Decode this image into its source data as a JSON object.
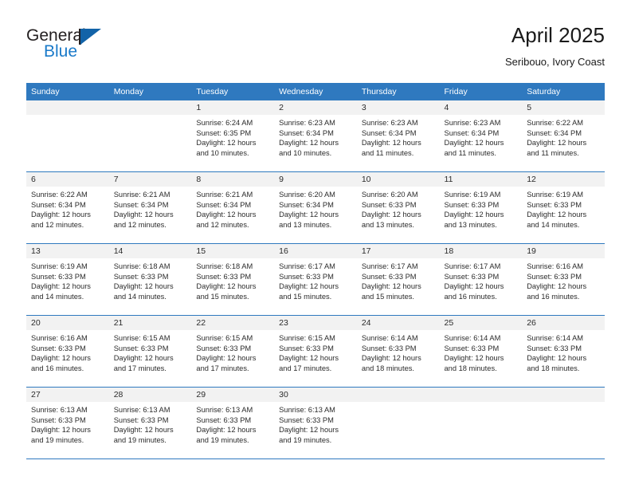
{
  "brand": {
    "name_part1": "General",
    "name_part2": "Blue",
    "logo_icon": "triangle-flag-icon"
  },
  "header": {
    "title": "April 2025",
    "subtitle": "Seribouo, Ivory Coast"
  },
  "calendar": {
    "theme_color": "#2f79bf",
    "weekday_headers": [
      "Sunday",
      "Monday",
      "Tuesday",
      "Wednesday",
      "Thursday",
      "Friday",
      "Saturday"
    ],
    "labels": {
      "sunrise": "Sunrise:",
      "sunset": "Sunset:",
      "daylight": "Daylight:"
    },
    "weeks": [
      [
        {
          "day": "",
          "empty": true
        },
        {
          "day": "",
          "empty": true
        },
        {
          "day": "1",
          "sunrise": "Sunrise: 6:24 AM",
          "sunset": "Sunset: 6:35 PM",
          "daylight_line1": "Daylight: 12 hours",
          "daylight_line2": "and 10 minutes."
        },
        {
          "day": "2",
          "sunrise": "Sunrise: 6:23 AM",
          "sunset": "Sunset: 6:34 PM",
          "daylight_line1": "Daylight: 12 hours",
          "daylight_line2": "and 10 minutes."
        },
        {
          "day": "3",
          "sunrise": "Sunrise: 6:23 AM",
          "sunset": "Sunset: 6:34 PM",
          "daylight_line1": "Daylight: 12 hours",
          "daylight_line2": "and 11 minutes."
        },
        {
          "day": "4",
          "sunrise": "Sunrise: 6:23 AM",
          "sunset": "Sunset: 6:34 PM",
          "daylight_line1": "Daylight: 12 hours",
          "daylight_line2": "and 11 minutes."
        },
        {
          "day": "5",
          "sunrise": "Sunrise: 6:22 AM",
          "sunset": "Sunset: 6:34 PM",
          "daylight_line1": "Daylight: 12 hours",
          "daylight_line2": "and 11 minutes."
        }
      ],
      [
        {
          "day": "6",
          "sunrise": "Sunrise: 6:22 AM",
          "sunset": "Sunset: 6:34 PM",
          "daylight_line1": "Daylight: 12 hours",
          "daylight_line2": "and 12 minutes."
        },
        {
          "day": "7",
          "sunrise": "Sunrise: 6:21 AM",
          "sunset": "Sunset: 6:34 PM",
          "daylight_line1": "Daylight: 12 hours",
          "daylight_line2": "and 12 minutes."
        },
        {
          "day": "8",
          "sunrise": "Sunrise: 6:21 AM",
          "sunset": "Sunset: 6:34 PM",
          "daylight_line1": "Daylight: 12 hours",
          "daylight_line2": "and 12 minutes."
        },
        {
          "day": "9",
          "sunrise": "Sunrise: 6:20 AM",
          "sunset": "Sunset: 6:34 PM",
          "daylight_line1": "Daylight: 12 hours",
          "daylight_line2": "and 13 minutes."
        },
        {
          "day": "10",
          "sunrise": "Sunrise: 6:20 AM",
          "sunset": "Sunset: 6:33 PM",
          "daylight_line1": "Daylight: 12 hours",
          "daylight_line2": "and 13 minutes."
        },
        {
          "day": "11",
          "sunrise": "Sunrise: 6:19 AM",
          "sunset": "Sunset: 6:33 PM",
          "daylight_line1": "Daylight: 12 hours",
          "daylight_line2": "and 13 minutes."
        },
        {
          "day": "12",
          "sunrise": "Sunrise: 6:19 AM",
          "sunset": "Sunset: 6:33 PM",
          "daylight_line1": "Daylight: 12 hours",
          "daylight_line2": "and 14 minutes."
        }
      ],
      [
        {
          "day": "13",
          "sunrise": "Sunrise: 6:19 AM",
          "sunset": "Sunset: 6:33 PM",
          "daylight_line1": "Daylight: 12 hours",
          "daylight_line2": "and 14 minutes."
        },
        {
          "day": "14",
          "sunrise": "Sunrise: 6:18 AM",
          "sunset": "Sunset: 6:33 PM",
          "daylight_line1": "Daylight: 12 hours",
          "daylight_line2": "and 14 minutes."
        },
        {
          "day": "15",
          "sunrise": "Sunrise: 6:18 AM",
          "sunset": "Sunset: 6:33 PM",
          "daylight_line1": "Daylight: 12 hours",
          "daylight_line2": "and 15 minutes."
        },
        {
          "day": "16",
          "sunrise": "Sunrise: 6:17 AM",
          "sunset": "Sunset: 6:33 PM",
          "daylight_line1": "Daylight: 12 hours",
          "daylight_line2": "and 15 minutes."
        },
        {
          "day": "17",
          "sunrise": "Sunrise: 6:17 AM",
          "sunset": "Sunset: 6:33 PM",
          "daylight_line1": "Daylight: 12 hours",
          "daylight_line2": "and 15 minutes."
        },
        {
          "day": "18",
          "sunrise": "Sunrise: 6:17 AM",
          "sunset": "Sunset: 6:33 PM",
          "daylight_line1": "Daylight: 12 hours",
          "daylight_line2": "and 16 minutes."
        },
        {
          "day": "19",
          "sunrise": "Sunrise: 6:16 AM",
          "sunset": "Sunset: 6:33 PM",
          "daylight_line1": "Daylight: 12 hours",
          "daylight_line2": "and 16 minutes."
        }
      ],
      [
        {
          "day": "20",
          "sunrise": "Sunrise: 6:16 AM",
          "sunset": "Sunset: 6:33 PM",
          "daylight_line1": "Daylight: 12 hours",
          "daylight_line2": "and 16 minutes."
        },
        {
          "day": "21",
          "sunrise": "Sunrise: 6:15 AM",
          "sunset": "Sunset: 6:33 PM",
          "daylight_line1": "Daylight: 12 hours",
          "daylight_line2": "and 17 minutes."
        },
        {
          "day": "22",
          "sunrise": "Sunrise: 6:15 AM",
          "sunset": "Sunset: 6:33 PM",
          "daylight_line1": "Daylight: 12 hours",
          "daylight_line2": "and 17 minutes."
        },
        {
          "day": "23",
          "sunrise": "Sunrise: 6:15 AM",
          "sunset": "Sunset: 6:33 PM",
          "daylight_line1": "Daylight: 12 hours",
          "daylight_line2": "and 17 minutes."
        },
        {
          "day": "24",
          "sunrise": "Sunrise: 6:14 AM",
          "sunset": "Sunset: 6:33 PM",
          "daylight_line1": "Daylight: 12 hours",
          "daylight_line2": "and 18 minutes."
        },
        {
          "day": "25",
          "sunrise": "Sunrise: 6:14 AM",
          "sunset": "Sunset: 6:33 PM",
          "daylight_line1": "Daylight: 12 hours",
          "daylight_line2": "and 18 minutes."
        },
        {
          "day": "26",
          "sunrise": "Sunrise: 6:14 AM",
          "sunset": "Sunset: 6:33 PM",
          "daylight_line1": "Daylight: 12 hours",
          "daylight_line2": "and 18 minutes."
        }
      ],
      [
        {
          "day": "27",
          "sunrise": "Sunrise: 6:13 AM",
          "sunset": "Sunset: 6:33 PM",
          "daylight_line1": "Daylight: 12 hours",
          "daylight_line2": "and 19 minutes."
        },
        {
          "day": "28",
          "sunrise": "Sunrise: 6:13 AM",
          "sunset": "Sunset: 6:33 PM",
          "daylight_line1": "Daylight: 12 hours",
          "daylight_line2": "and 19 minutes."
        },
        {
          "day": "29",
          "sunrise": "Sunrise: 6:13 AM",
          "sunset": "Sunset: 6:33 PM",
          "daylight_line1": "Daylight: 12 hours",
          "daylight_line2": "and 19 minutes."
        },
        {
          "day": "30",
          "sunrise": "Sunrise: 6:13 AM",
          "sunset": "Sunset: 6:33 PM",
          "daylight_line1": "Daylight: 12 hours",
          "daylight_line2": "and 19 minutes."
        },
        {
          "day": "",
          "empty": true
        },
        {
          "day": "",
          "empty": true
        },
        {
          "day": "",
          "empty": true
        }
      ]
    ]
  }
}
